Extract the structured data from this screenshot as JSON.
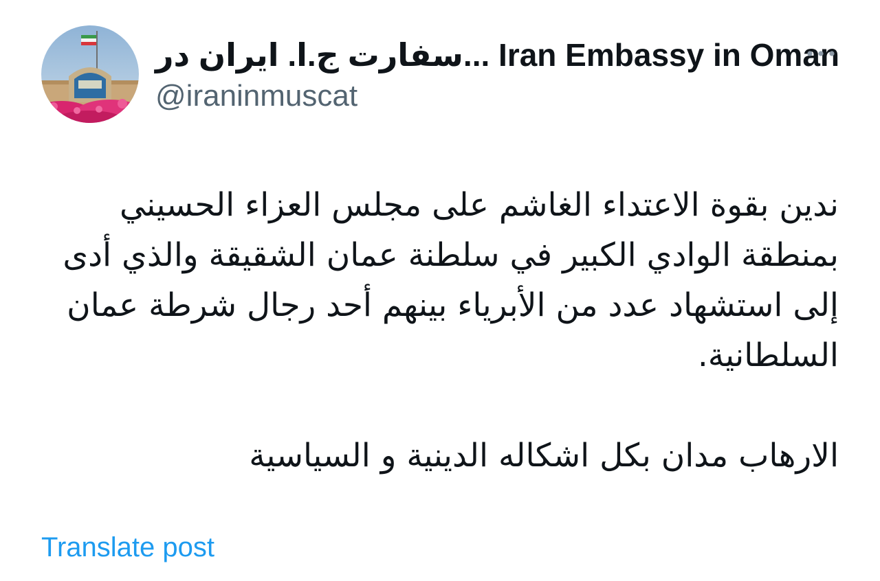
{
  "post": {
    "author": {
      "display_name": "سفارت ج.ا. ایران در... Iran Embassy in Oman",
      "handle": "@iraninmuscat",
      "avatar": "embassy-building-avatar"
    },
    "more_icon": "ellipsis-icon",
    "paragraphs": [
      "ندين بقوة الاعتداء الغاشم على مجلس العزاء الحسيني بمنطقة الوادي الكبير في سلطنة عمان الشقيقة والذي أدى إلى استشهاد عدد من الأبرياء بينهم أحد رجال شرطة عمان السلطانية.",
      "الارهاب مدان بكل اشكاله الدينية و السياسية"
    ],
    "translate_label": "Translate post"
  },
  "colors": {
    "text": "#0f1419",
    "secondary": "#536471",
    "link": "#1d9bf0",
    "background": "#ffffff"
  }
}
